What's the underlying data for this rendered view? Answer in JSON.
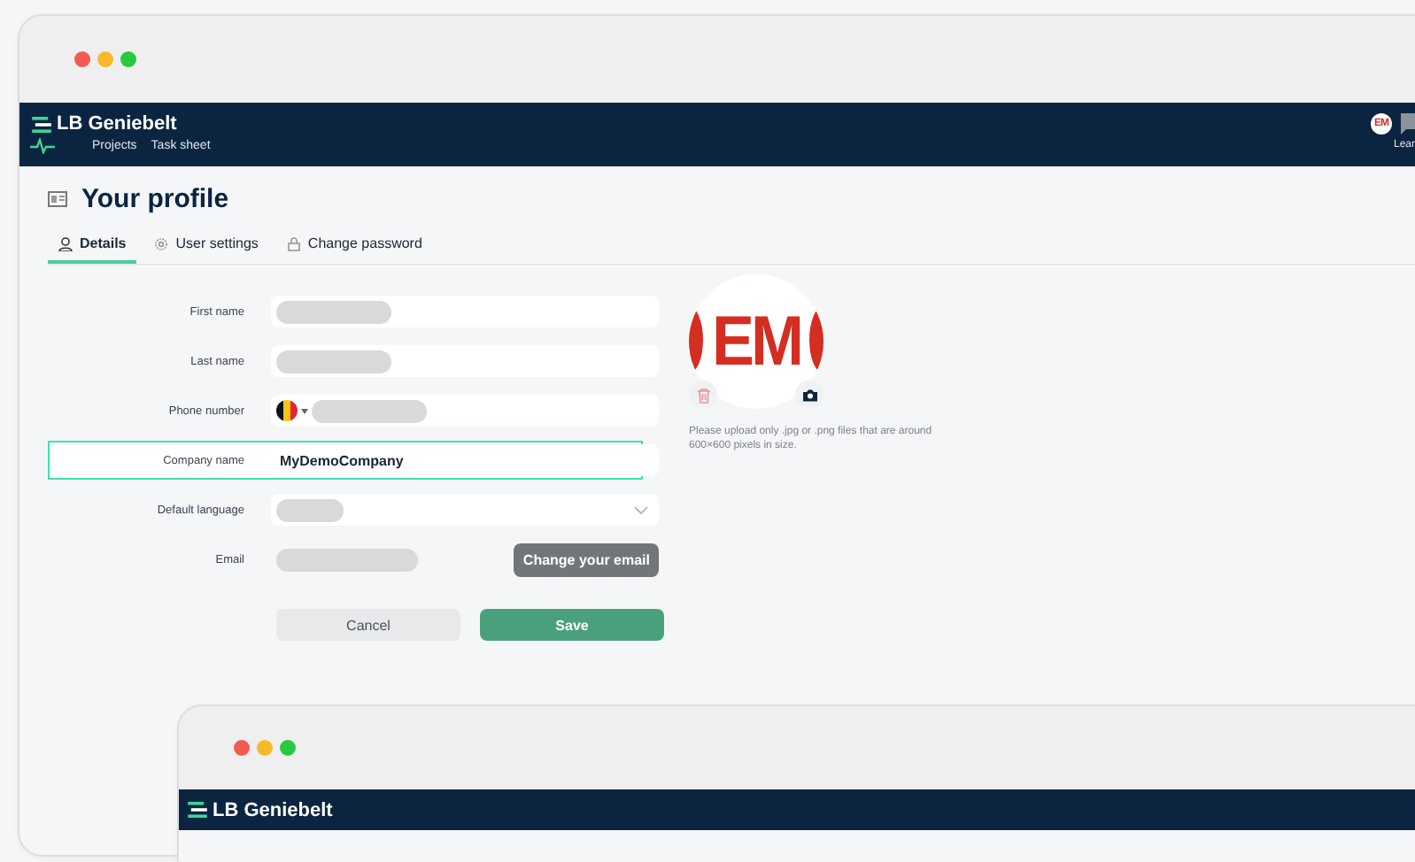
{
  "app": {
    "brand": "LB Geniebelt",
    "nav": [
      {
        "label": "Projects"
      },
      {
        "label": "Task sheet"
      }
    ],
    "avatar_initials": "EM",
    "help_label": "Lear"
  },
  "page": {
    "title": "Your profile",
    "tabs": [
      {
        "label": "Details",
        "selected": true
      },
      {
        "label": "User settings",
        "selected": false
      },
      {
        "label": "Change password",
        "selected": false
      }
    ]
  },
  "form": {
    "fields": [
      {
        "label": "First name",
        "kind": "redacted",
        "highlighted": false
      },
      {
        "label": "Last name",
        "kind": "redacted",
        "highlighted": false
      },
      {
        "label": "Phone number",
        "kind": "phone",
        "highlighted": false
      },
      {
        "label": "Company name",
        "kind": "text",
        "value": "MyDemoCompany",
        "highlighted": true
      },
      {
        "label": "Default language",
        "kind": "select",
        "highlighted": false
      },
      {
        "label": "Email",
        "kind": "email",
        "action": "Change your email",
        "highlighted": false
      }
    ],
    "buttons": [
      {
        "label": "Cancel",
        "kind": "secondary"
      },
      {
        "label": "Save",
        "kind": "primary"
      }
    ]
  },
  "photo": {
    "initials": "EM",
    "hint": "Please upload only .jpg or .png files that are around 600×600 pixels in size."
  },
  "second_window": {
    "brand": "LB Geniebelt"
  }
}
